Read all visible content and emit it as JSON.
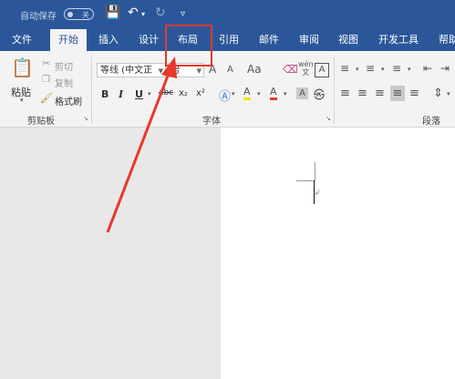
{
  "titlebar": {
    "autosave_label": "自动保存",
    "autosave_state": "关"
  },
  "tabs": [
    "文件",
    "开始",
    "插入",
    "设计",
    "布局",
    "引用",
    "邮件",
    "审阅",
    "视图",
    "开发工具",
    "帮助"
  ],
  "active_tab": "开始",
  "clipboard": {
    "paste": "粘贴",
    "cut": "剪切",
    "copy": "复制",
    "format_painter": "格式刷",
    "group": "剪贴板"
  },
  "font": {
    "name": "等线 (中文正文)",
    "name_display": "等线 (中文正",
    "size": "五号",
    "size_display": "号",
    "group": "字体",
    "grow": "A",
    "shrink": "A",
    "change_case": "Aa",
    "bold": "B",
    "italic": "I",
    "underline": "U",
    "strike": "abc",
    "subscript": "x₂",
    "superscript": "x²",
    "highlight_char": "A",
    "font_color_char": "A",
    "char_shading": "A",
    "pinyin_top": "wén",
    "pinyin_bottom": "文"
  },
  "paragraph": {
    "group": "段落"
  },
  "annotation": {
    "box_color": "#e8382b",
    "arrow_color": "#e8382b",
    "highlights": "布局"
  },
  "colors": {
    "ribbon_blue": "#2b579a",
    "ribbon_bg": "#f3f3f3"
  }
}
